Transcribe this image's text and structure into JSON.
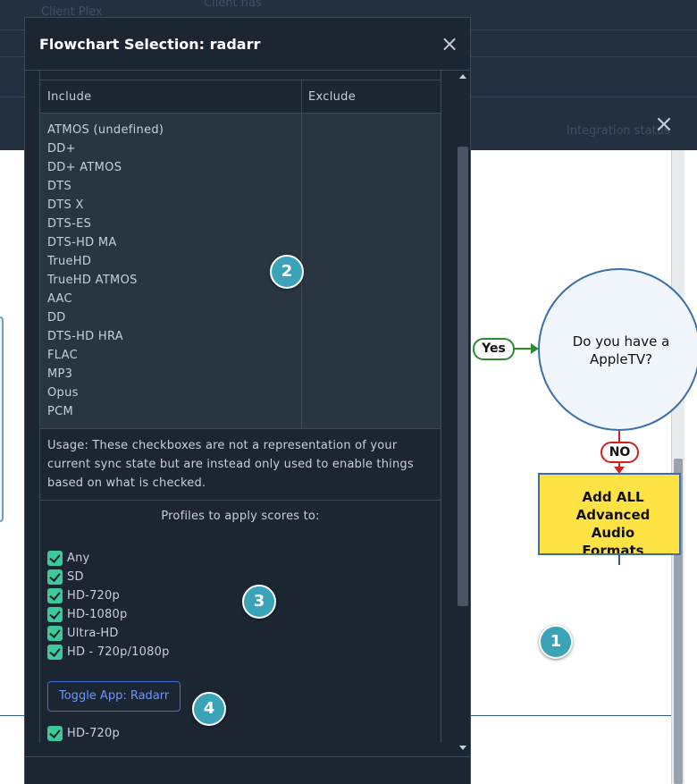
{
  "background": {
    "faint_text_1": "Client Plex",
    "faint_text_2": "Client nas",
    "faint_text_3": "Integration status"
  },
  "flowchart": {
    "yes_label": "Yes",
    "no_label": "NO",
    "question": "Do you have a AppleTV?",
    "action_box": "Add ALL Advanced Audio Formats"
  },
  "modal": {
    "title": "Flowchart Selection: radarr",
    "table": {
      "include_header": "Include",
      "exclude_header": "Exclude",
      "include_items": [
        "ATMOS (undefined)",
        "DD+",
        "DD+ ATMOS",
        "DTS",
        "DTS X",
        "DTS-ES",
        "DTS-HD MA",
        "TrueHD",
        "TrueHD ATMOS",
        "AAC",
        "DD",
        "DTS-HD HRA",
        "FLAC",
        "MP3",
        "Opus",
        "PCM"
      ]
    },
    "usage_text": "Usage: These checkboxes are not a representation of your current sync state but are instead only used to enable things based on what is checked.",
    "profiles_title": "Profiles to apply scores to:",
    "profiles": [
      {
        "label": "Any",
        "checked": true
      },
      {
        "label": "SD",
        "checked": true
      },
      {
        "label": "HD-720p",
        "checked": true
      },
      {
        "label": "HD-1080p",
        "checked": true
      },
      {
        "label": "Ultra-HD",
        "checked": true
      },
      {
        "label": "HD - 720p/1080p",
        "checked": true
      }
    ],
    "toggle_button": "Toggle App: Radarr",
    "second_profiles": [
      {
        "label": "HD-720p",
        "checked": true
      }
    ]
  },
  "annotations": {
    "badge_1": "1",
    "badge_2": "2",
    "badge_3": "3",
    "badge_4": "4"
  },
  "colors": {
    "accent": "#3aa3b8",
    "checkbox": "#3ec99a",
    "button_border": "#3d6fd8",
    "action_box_fill": "#ffe345"
  }
}
